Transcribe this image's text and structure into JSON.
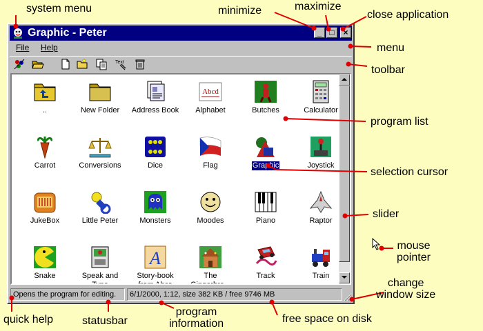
{
  "window": {
    "title": "Graphic - Peter",
    "buttons": {
      "minimize": "_",
      "maximize": "□",
      "close": "×"
    }
  },
  "menubar": {
    "items": [
      {
        "label": "File"
      },
      {
        "label": "Help"
      }
    ]
  },
  "toolbar": {
    "tools": [
      {
        "icon": "run-program-icon"
      },
      {
        "icon": "open-folder-icon"
      },
      {
        "icon": "new-file-icon"
      },
      {
        "icon": "new-folder-icon"
      },
      {
        "icon": "copy-icon"
      },
      {
        "icon": "text-icon",
        "label": "Text"
      },
      {
        "icon": "trash-icon"
      }
    ]
  },
  "programs": {
    "selected": "Graphic",
    "items": [
      {
        "label": "..",
        "icon": "up-folder-icon"
      },
      {
        "label": "New Folder",
        "icon": "folder-icon"
      },
      {
        "label": "Address Book",
        "icon": "address-book-icon"
      },
      {
        "label": "Alphabet",
        "icon": "alphabet-icon",
        "icon_text": "Abcd"
      },
      {
        "label": "Butches",
        "icon": "butches-icon"
      },
      {
        "label": "Calculator",
        "icon": "calculator-icon"
      },
      {
        "label": "Carrot",
        "icon": "carrot-icon"
      },
      {
        "label": "Conversions",
        "icon": "scales-icon"
      },
      {
        "label": "Dice",
        "icon": "dice-icon"
      },
      {
        "label": "Flag",
        "icon": "flag-icon"
      },
      {
        "label": "Graphic",
        "icon": "graphic-shapes-icon"
      },
      {
        "label": "Joystick",
        "icon": "joystick-icon"
      },
      {
        "label": "JukeBox",
        "icon": "jukebox-icon"
      },
      {
        "label": "Little Peter",
        "icon": "pacifier-icon"
      },
      {
        "label": "Monsters",
        "icon": "monster-icon"
      },
      {
        "label": "Moodes",
        "icon": "smiley-icon"
      },
      {
        "label": "Piano",
        "icon": "piano-icon"
      },
      {
        "label": "Raptor",
        "icon": "spaceship-icon"
      },
      {
        "label": "Snake",
        "icon": "snake-icon"
      },
      {
        "label": "Speak and Type",
        "icon": "speak-type-icon"
      },
      {
        "label": "Story-book from Abcs",
        "icon": "storybook-icon",
        "icon_text": "A"
      },
      {
        "label": "The Gingerbre...",
        "icon": "gingerbread-house-icon"
      },
      {
        "label": "Track",
        "icon": "track-car-icon"
      },
      {
        "label": "Train",
        "icon": "train-icon"
      }
    ]
  },
  "statusbar": {
    "help": "Opens the program for editing.",
    "info": "6/1/2000, 1:12, size 382 KB / free  9746 MB"
  },
  "annotations": {
    "system_menu": "system menu",
    "minimize": "minimize",
    "maximize": "maximize",
    "close_application": "close application",
    "menu": "menu",
    "toolbar": "toolbar",
    "program_list": "program list",
    "selection_cursor": "selection cursor",
    "slider": "slider",
    "mouse_pointer": "mouse\npointer",
    "change_window_size": "change\nwindow size",
    "quick_help": "quick help",
    "statusbar": "statusbar",
    "program_information": "program\ninformation",
    "free_space_on_disk": "free space on disk"
  },
  "colors": {
    "background": "#fdfdc0",
    "title_bar": "#000080",
    "window_face": "#c0c0c0",
    "annotation_line": "#e00000"
  }
}
